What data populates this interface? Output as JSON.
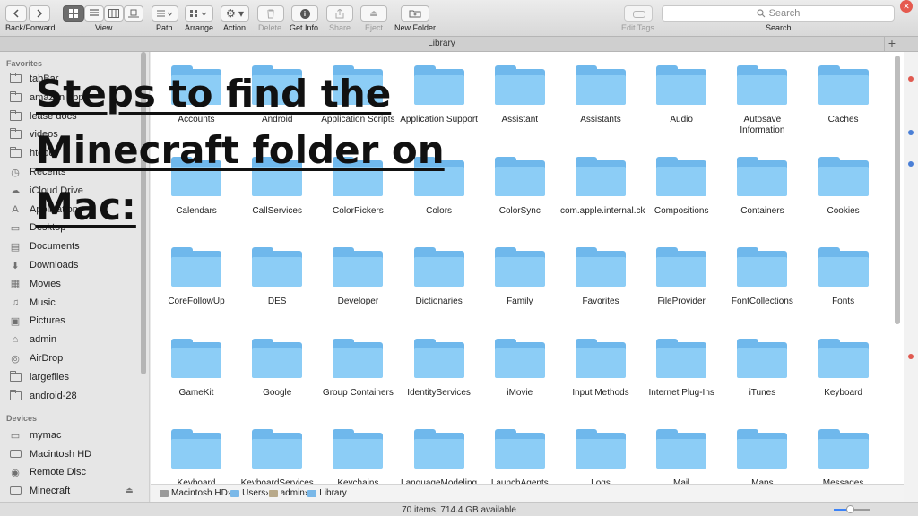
{
  "toolbar": {
    "labels": {
      "back_forward": "Back/Forward",
      "view": "View",
      "path": "Path",
      "arrange": "Arrange",
      "action": "Action",
      "delete": "Delete",
      "get_info": "Get Info",
      "share": "Share",
      "eject": "Eject",
      "new_folder": "New Folder",
      "edit_tags": "Edit Tags",
      "search": "Search"
    },
    "search_placeholder": "Search"
  },
  "tab": {
    "title": "Library",
    "plus": "+"
  },
  "sidebar": {
    "favorites_heading": "Favorites",
    "devices_heading": "Devices",
    "favorites": [
      {
        "label": "tabBar",
        "icon": "folder-icon"
      },
      {
        "label": "amazon apps",
        "icon": "folder-icon"
      },
      {
        "label": "lease docs",
        "icon": "folder-icon"
      },
      {
        "label": "videos",
        "icon": "folder-icon"
      },
      {
        "label": "htdocs",
        "icon": "folder-icon"
      },
      {
        "label": "Recents",
        "icon": "clock-icon"
      },
      {
        "label": "iCloud Drive",
        "icon": "cloud-icon"
      },
      {
        "label": "Applications",
        "icon": "applications-icon"
      },
      {
        "label": "Desktop",
        "icon": "desktop-icon"
      },
      {
        "label": "Documents",
        "icon": "documents-icon"
      },
      {
        "label": "Downloads",
        "icon": "downloads-icon"
      },
      {
        "label": "Movies",
        "icon": "movies-icon"
      },
      {
        "label": "Music",
        "icon": "music-icon"
      },
      {
        "label": "Pictures",
        "icon": "pictures-icon"
      },
      {
        "label": "admin",
        "icon": "home-icon"
      },
      {
        "label": "AirDrop",
        "icon": "airdrop-icon"
      },
      {
        "label": "largefiles",
        "icon": "folder-icon"
      },
      {
        "label": "android-28",
        "icon": "folder-icon"
      }
    ],
    "devices": [
      {
        "label": "mymac",
        "icon": "computer-icon"
      },
      {
        "label": "Macintosh HD",
        "icon": "disk-icon"
      },
      {
        "label": "Remote Disc",
        "icon": "disc-icon"
      },
      {
        "label": "Minecraft",
        "icon": "disk-icon",
        "eject": "⏏"
      }
    ]
  },
  "folders": [
    [
      "Accounts",
      "Android",
      "Application Scripts",
      "Application Support",
      "Assistant",
      "Assistants",
      "Audio",
      "Autosave Information",
      "Caches"
    ],
    [
      "Calendars",
      "CallServices",
      "ColorPickers",
      "Colors",
      "ColorSync",
      "com.apple.internal.ck",
      "Compositions",
      "Containers",
      "Cookies"
    ],
    [
      "CoreFollowUp",
      "DES",
      "Developer",
      "Dictionaries",
      "Family",
      "Favorites",
      "FileProvider",
      "FontCollections",
      "Fonts"
    ],
    [
      "GameKit",
      "Google",
      "Group Containers",
      "IdentityServices",
      "iMovie",
      "Input Methods",
      "Internet Plug-Ins",
      "iTunes",
      "Keyboard"
    ],
    [
      "Keyboard",
      "KeyboardServices",
      "Keychains",
      "LanguageModeling",
      "LaunchAgents",
      "Logs",
      "Mail",
      "Maps",
      "Messages"
    ]
  ],
  "path": [
    "Macintosh HD",
    "Users",
    "admin",
    "Library"
  ],
  "status": "70 items, 714.4 GB available",
  "icon_size_level": 0.45,
  "overlay": {
    "line1": "Steps to find the",
    "line2": "Minecraft folder on",
    "line3": "Mac:"
  },
  "colors": {
    "folder_back": "#6fb8ec",
    "folder_front": "#8ccdf6",
    "accent": "#3b82f7"
  }
}
